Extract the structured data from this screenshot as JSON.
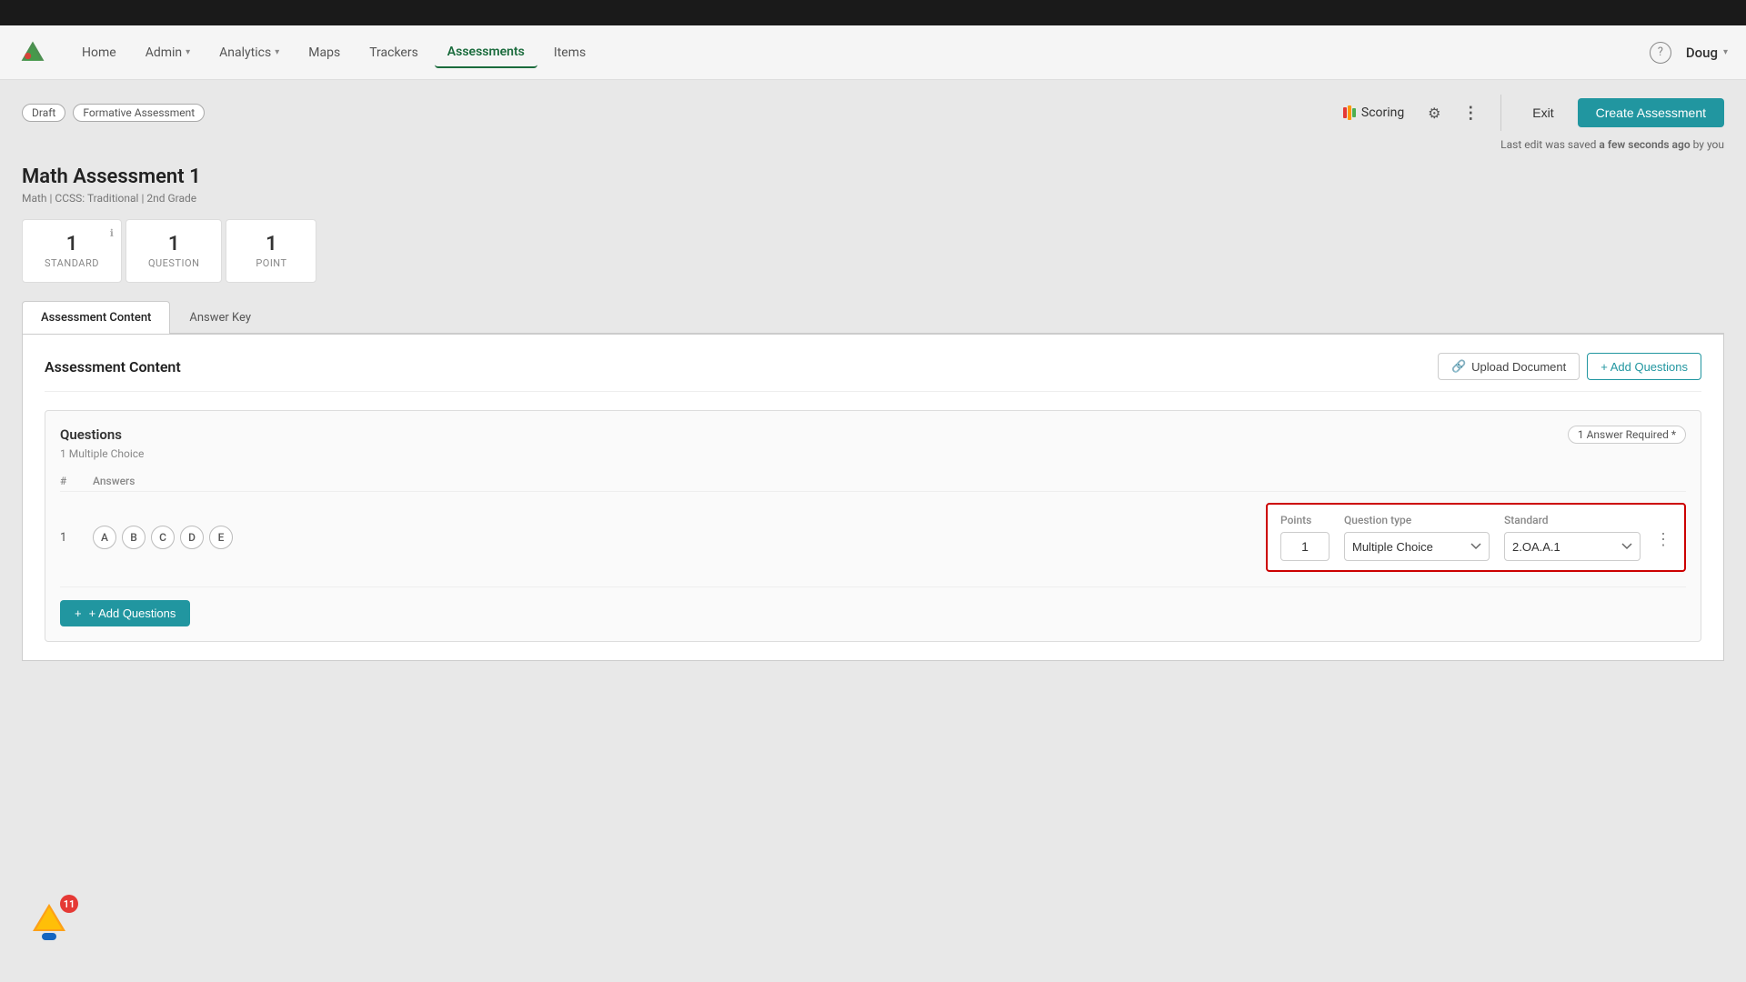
{
  "topBar": {},
  "navbar": {
    "logo_alt": "App Logo",
    "links": [
      {
        "label": "Home",
        "active": false
      },
      {
        "label": "Admin",
        "active": false,
        "hasDropdown": true
      },
      {
        "label": "Analytics",
        "active": false,
        "hasDropdown": true
      },
      {
        "label": "Maps",
        "active": false
      },
      {
        "label": "Trackers",
        "active": false
      },
      {
        "label": "Assessments",
        "active": true
      },
      {
        "label": "Items",
        "active": false
      }
    ],
    "user": "Doug",
    "help_label": "?"
  },
  "assessmentBar": {
    "draft_badge": "Draft",
    "type_badge": "Formative Assessment",
    "scoring_label": "Scoring",
    "exit_label": "Exit",
    "create_btn": "Create Assessment",
    "last_edit": "Last edit was saved",
    "last_edit_time": "a few seconds ago",
    "last_edit_suffix": "by you"
  },
  "assessment": {
    "title": "Math Assessment 1",
    "meta": "Math | CCSS: Traditional | 2nd Grade",
    "stats": [
      {
        "number": "1",
        "label": "STANDARD"
      },
      {
        "number": "1",
        "label": "QUESTION"
      },
      {
        "number": "1",
        "label": "POINT"
      }
    ]
  },
  "tabs": [
    {
      "label": "Assessment Content",
      "active": true
    },
    {
      "label": "Answer Key",
      "active": false
    }
  ],
  "content": {
    "section_title": "Assessment Content",
    "upload_doc_btn": "Upload Document",
    "add_questions_btn": "+ Add Questions"
  },
  "questions": {
    "title": "Questions",
    "subtitle": "1 Multiple Choice",
    "answer_required_badge": "1 Answer Required *",
    "table": {
      "headers": [
        "#",
        "Answers",
        "Points",
        "Question type",
        "Standard"
      ],
      "rows": [
        {
          "number": "1",
          "answers": [
            "A",
            "B",
            "C",
            "D",
            "E"
          ],
          "points": "1",
          "question_type": "Multiple Choice",
          "standard": "2.OA.A.1"
        }
      ]
    },
    "add_questions_btn": "+ Add Questions"
  },
  "notification": {
    "count": "11"
  }
}
